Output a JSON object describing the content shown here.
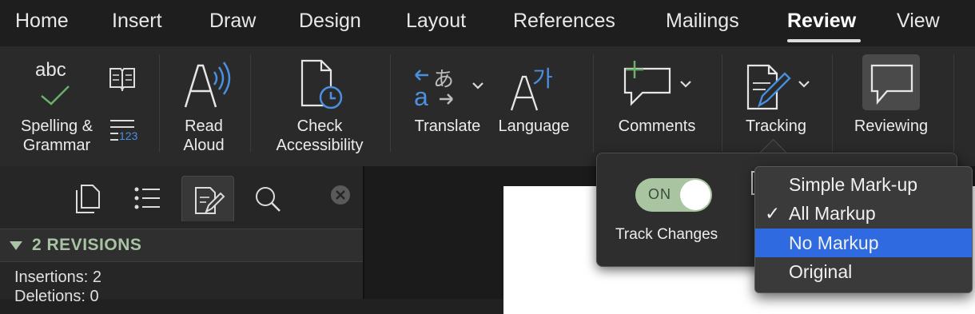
{
  "tabs": [
    {
      "label": "Home"
    },
    {
      "label": "Insert"
    },
    {
      "label": "Draw"
    },
    {
      "label": "Design"
    },
    {
      "label": "Layout"
    },
    {
      "label": "References"
    },
    {
      "label": "Mailings"
    },
    {
      "label": "Review",
      "active": true
    },
    {
      "label": "View"
    }
  ],
  "ribbon": {
    "spelling": {
      "line1": "Spelling &",
      "line2": "Grammar",
      "icon_text": "abc",
      "icon": "abc-checkmark-icon"
    },
    "thesaurus": {
      "icon": "book-icon"
    },
    "word_count": {
      "icon_text": "123",
      "icon": "word-count-icon"
    },
    "read_aloud": {
      "line1": "Read",
      "line2": "Aloud",
      "icon": "speaker-a-icon"
    },
    "accessibility": {
      "line1": "Check",
      "line2": "Accessibility",
      "icon": "document-clock-icon"
    },
    "translate": {
      "label": "Translate",
      "icon": "translate-icon"
    },
    "language": {
      "label": "Language",
      "icon": "language-icon"
    },
    "comments": {
      "label": "Comments",
      "icon": "new-comment-icon"
    },
    "tracking": {
      "label": "Tracking",
      "icon": "document-pen-icon"
    },
    "reviewing": {
      "label": "Reviewing",
      "icon": "speech-bubble-icon"
    }
  },
  "revisions_pane": {
    "title": "2 REVISIONS",
    "insertions": "Insertions: 2",
    "deletions": "Deletions: 0"
  },
  "tracking_popover": {
    "toggle_state": "ON",
    "toggle_label": "Track Changes"
  },
  "markup_menu": {
    "items": [
      {
        "label": "Simple Mark-up"
      },
      {
        "label": "All Markup",
        "checked": true
      },
      {
        "label": "No Markup",
        "highlighted": true
      },
      {
        "label": "Original"
      }
    ],
    "check_mark": "✓"
  },
  "colors": {
    "accent_blue": "#2f6ae0",
    "toggle_green": "#a8c4a0",
    "revisions_green": "#a9c4a4",
    "icon_blue": "#4a8fe0"
  }
}
